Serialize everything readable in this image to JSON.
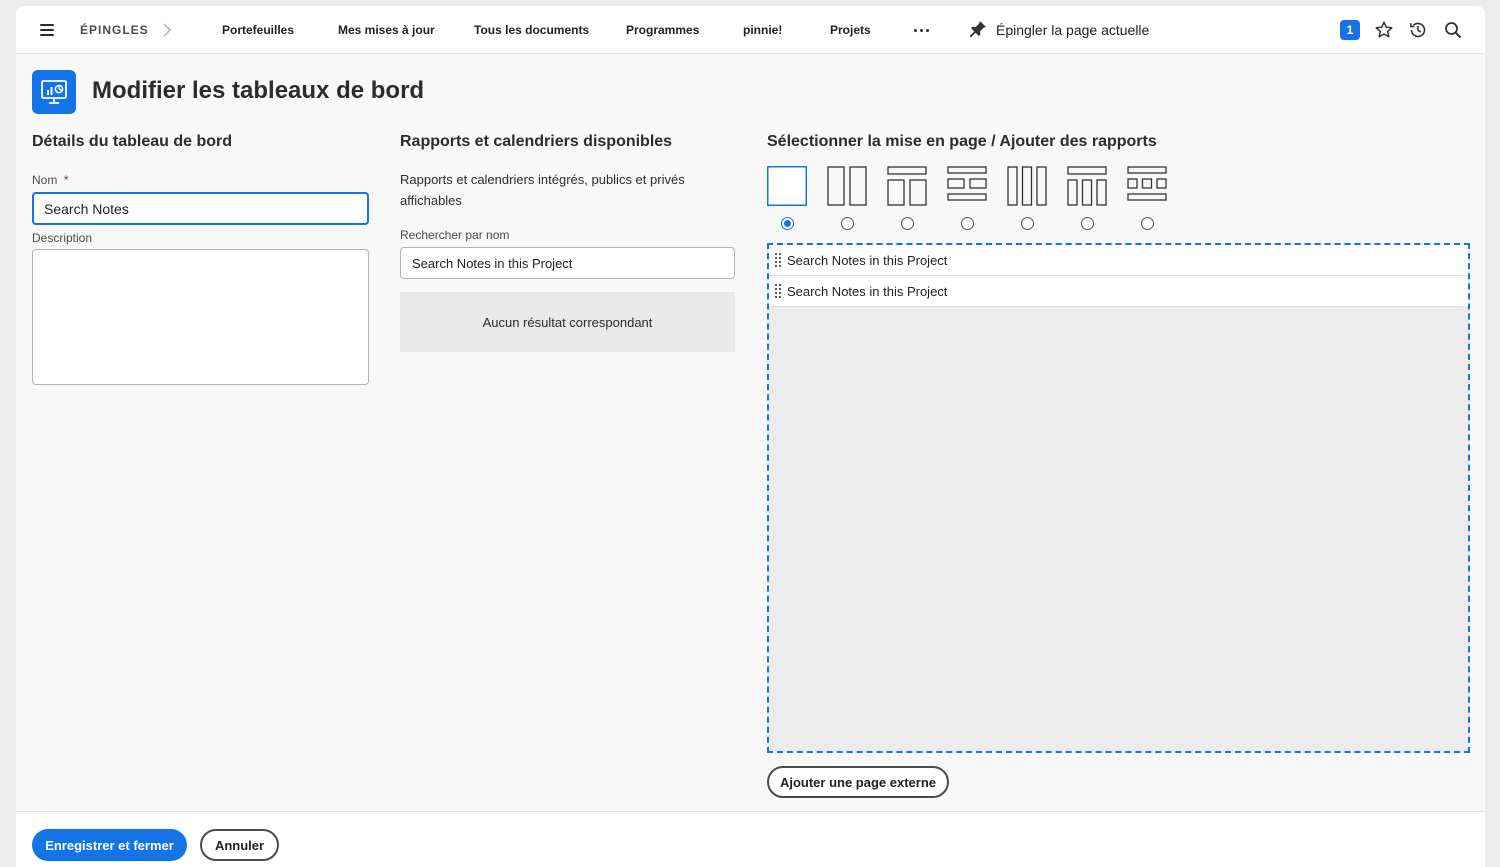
{
  "nav": {
    "pins_label": "ÉPINGLES",
    "links": [
      {
        "label": "Portefeuilles",
        "name": "nav-portefeuilles"
      },
      {
        "label": "Mes mises à jour",
        "name": "nav-mes-mises-a-jour"
      },
      {
        "label": "Tous les documents",
        "name": "nav-tous-les-documents"
      },
      {
        "label": "Programmes",
        "name": "nav-programmes"
      },
      {
        "label": "pinnie!",
        "name": "nav-pinnie"
      },
      {
        "label": "Projets",
        "name": "nav-projets"
      }
    ],
    "pin_current_label": "Épingler la page actuelle",
    "notification_count": "1",
    "icons": [
      "menu-icon",
      "chevron-right-icon",
      "more-icon",
      "pin-icon",
      "star-icon",
      "history-icon",
      "search-icon"
    ]
  },
  "page": {
    "title": "Modifier les tableaux de bord",
    "icon": "dashboard-icon",
    "accent_color": "#1473e6"
  },
  "details": {
    "heading": "Détails du tableau de bord",
    "name_label": "Nom",
    "required_mark": "*",
    "name_value": "Search Notes",
    "description_label": "Description",
    "description_value": ""
  },
  "available": {
    "heading": "Rapports et calendriers disponibles",
    "description": "Rapports et calendriers intégrés, publics et privés affichables",
    "search_label": "Rechercher par nom",
    "search_value": "Search Notes in this Project",
    "no_results": "Aucun résultat correspondant"
  },
  "layout": {
    "heading": "Sélectionner la mise en page / Ajouter des rapports",
    "options": [
      "single-column",
      "two-columns",
      "header-two-columns",
      "rows-two-columns",
      "three-columns",
      "header-three-columns",
      "rows-three-columns"
    ],
    "selected_index": 0,
    "reports": [
      "Search Notes in this Project",
      "Search Notes in this Project"
    ],
    "add_external_label": "Ajouter une page externe"
  },
  "footer": {
    "save_label": "Enregistrer et fermer",
    "cancel_label": "Annuler"
  }
}
